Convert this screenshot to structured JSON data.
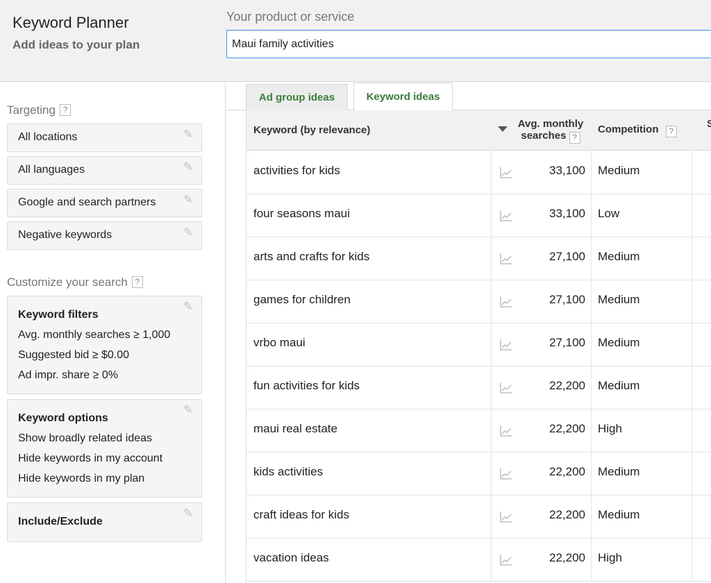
{
  "header": {
    "title": "Keyword Planner",
    "subtitle": "Add ideas to your plan",
    "product_label": "Your product or service",
    "product_value": "Maui family activities"
  },
  "sidebar": {
    "targeting_label": "Targeting",
    "targeting_items": [
      {
        "label": "All locations"
      },
      {
        "label": "All languages"
      },
      {
        "label": "Google and search partners"
      },
      {
        "label": "Negative keywords"
      }
    ],
    "customize_label": "Customize your search",
    "keyword_filters": {
      "title": "Keyword filters",
      "lines": [
        "Avg. monthly searches ≥ 1,000",
        "Suggested bid ≥ $0.00",
        "Ad impr. share ≥ 0%"
      ]
    },
    "keyword_options": {
      "title": "Keyword options",
      "lines": [
        "Show broadly related ideas",
        "Hide keywords in my account",
        "Hide keywords in my plan"
      ]
    },
    "include_exclude": "Include/Exclude",
    "help_glyph": "?",
    "edit_glyph": "✎"
  },
  "tabs": [
    {
      "label": "Ad group ideas",
      "active": false
    },
    {
      "label": "Keyword ideas",
      "active": true
    }
  ],
  "table": {
    "col_keyword": "Keyword (by relevance)",
    "col_searches_line1": "Avg. monthly",
    "col_searches_line2": "searches",
    "col_competition": "Competition",
    "col_cut": "S",
    "rows": [
      {
        "keyword": "activities for kids",
        "searches": "33,100",
        "competition": "Medium"
      },
      {
        "keyword": "four seasons maui",
        "searches": "33,100",
        "competition": "Low"
      },
      {
        "keyword": "arts and crafts for kids",
        "searches": "27,100",
        "competition": "Medium"
      },
      {
        "keyword": "games for children",
        "searches": "27,100",
        "competition": "Medium"
      },
      {
        "keyword": "vrbo maui",
        "searches": "27,100",
        "competition": "Medium"
      },
      {
        "keyword": "fun activities for kids",
        "searches": "22,200",
        "competition": "Medium"
      },
      {
        "keyword": "maui real estate",
        "searches": "22,200",
        "competition": "High"
      },
      {
        "keyword": "kids activities",
        "searches": "22,200",
        "competition": "Medium"
      },
      {
        "keyword": "craft ideas for kids",
        "searches": "22,200",
        "competition": "Medium"
      },
      {
        "keyword": "vacation ideas",
        "searches": "22,200",
        "competition": "High"
      }
    ]
  },
  "colors": {
    "accent_green": "#3a7d3a",
    "input_focus_blue": "#4d90fe"
  }
}
